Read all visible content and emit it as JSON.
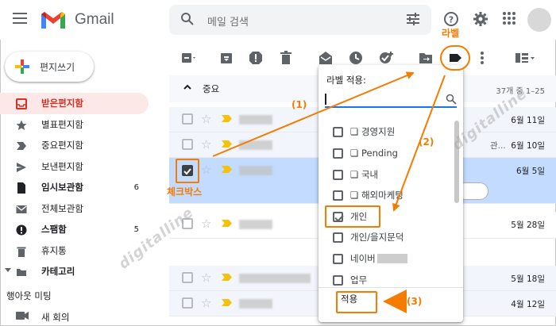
{
  "app": {
    "name": "Gmail"
  },
  "search": {
    "placeholder": "메일 검색"
  },
  "compose": {
    "label": "편지쓰기"
  },
  "nav": [
    {
      "label": "받은편지함",
      "count": "",
      "active": true,
      "bold": true,
      "icon": "inbox-icon"
    },
    {
      "label": "별표편지함",
      "count": "",
      "icon": "star-icon"
    },
    {
      "label": "중요편지함",
      "count": "",
      "icon": "important-icon"
    },
    {
      "label": "보낸편지함",
      "count": "",
      "icon": "send-icon"
    },
    {
      "label": "임시보관함",
      "count": "6",
      "bold": true,
      "icon": "draft-icon"
    },
    {
      "label": "전체보관함",
      "count": "",
      "icon": "mail-icon"
    },
    {
      "label": "스팸함",
      "count": "5",
      "bold": true,
      "icon": "spam-icon"
    },
    {
      "label": "휴지통",
      "count": "",
      "icon": "trash-icon"
    },
    {
      "label": "카테고리",
      "count": "",
      "bold": true,
      "icon": "category-icon"
    }
  ],
  "meet": {
    "title": "행아웃 미팅",
    "new_meeting": "새 회의"
  },
  "list": {
    "section_title": "중요",
    "range": "37개 중 1–25",
    "rows": [
      {
        "date": "6월 11일",
        "selected": false,
        "snippet": ""
      },
      {
        "date": "6월 10일",
        "selected": false,
        "snippet": "관..."
      },
      {
        "date": "6월 5일",
        "selected": true,
        "snippet": ""
      },
      {
        "date": "5월 28일",
        "selected": false,
        "snippet": ""
      },
      {
        "date": "5월 18일",
        "selected": false,
        "snippet": ""
      },
      {
        "date": "4월 12일",
        "selected": false,
        "snippet": ""
      }
    ]
  },
  "label_popup": {
    "title": "라벨 적용:",
    "labels": [
      {
        "text": "❏ 경영지원",
        "checked": false
      },
      {
        "text": "❏ Pending",
        "checked": false
      },
      {
        "text": "❏ 국내",
        "checked": false
      },
      {
        "text": "❏ 해외마케팅",
        "checked": false
      },
      {
        "text": "개인",
        "checked": true
      },
      {
        "text": "개인/을지문덕",
        "checked": false
      },
      {
        "text": "네이버",
        "checked": false,
        "blurred": true
      },
      {
        "text": "업무",
        "checked": false
      }
    ],
    "apply_label": "적용"
  },
  "annotations": {
    "label_caption": "라벨",
    "checkbox_caption": "체크박스",
    "step1": "(1)",
    "step2": "(2)",
    "step3": "(3)",
    "watermark": "digitalline"
  },
  "colors": {
    "accent": "#f57c00",
    "inbox_active": "#d93025",
    "selected_row": "#c2dbff",
    "link_blue": "#1a73e8"
  }
}
